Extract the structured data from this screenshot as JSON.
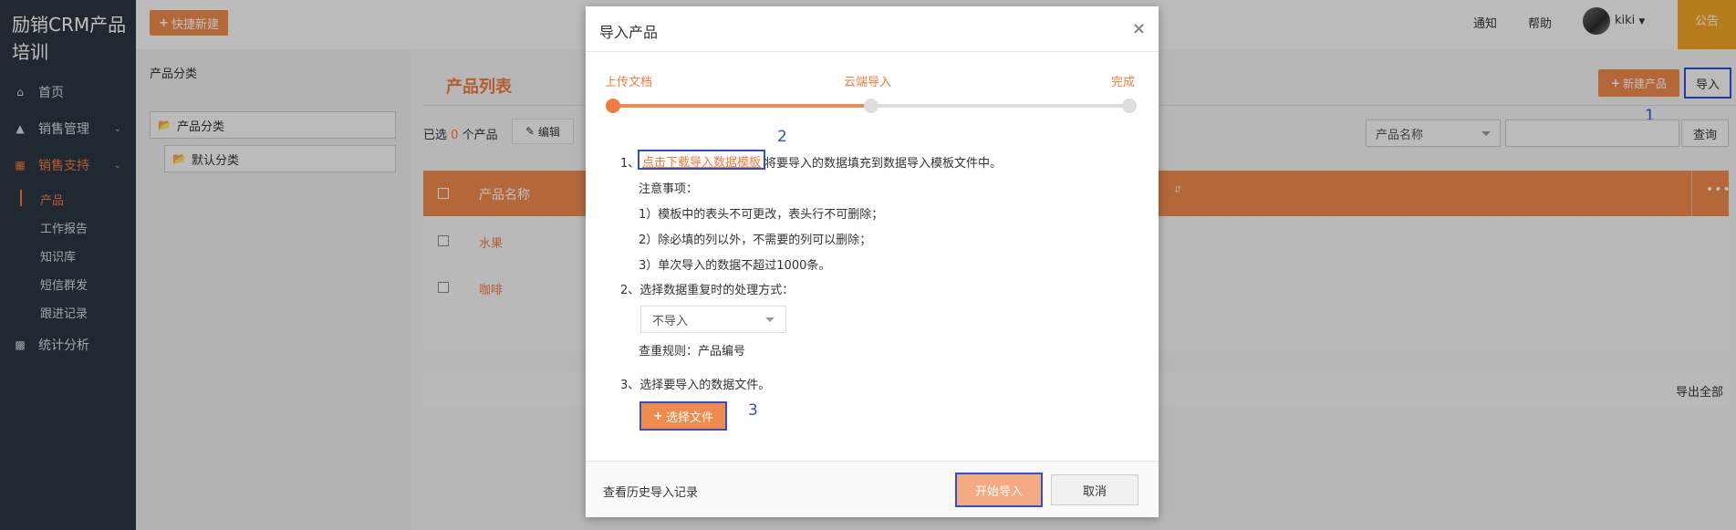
{
  "brand": "励销CRM产品培训",
  "sidebar": {
    "items": [
      {
        "label": "首页",
        "icon": "home-icon"
      },
      {
        "label": "销售管理",
        "icon": "area-chart-icon"
      },
      {
        "label": "销售支持",
        "icon": "file-icon"
      },
      {
        "label": "统计分析",
        "icon": "bar-chart-icon"
      }
    ],
    "sub_items": [
      "产品",
      "工作报告",
      "知识库",
      "短信群发",
      "跟进记录"
    ]
  },
  "header": {
    "quick_new": "快捷新建",
    "notify": "通知",
    "help": "帮助",
    "user": "kiki",
    "notice_tab": "公告"
  },
  "category": {
    "title": "产品分类",
    "root": "产品分类",
    "child": "默认分类"
  },
  "main": {
    "title": "产品列表",
    "new_product": "新建产品",
    "import": "导入",
    "selected_prefix": "已选",
    "selected_count": "0",
    "selected_suffix": "个产品",
    "edit": "编辑",
    "search_field": "产品名称",
    "query": "查询",
    "column_name": "产品名称",
    "rows": [
      "水果",
      "咖啡"
    ],
    "export_all": "导出全部"
  },
  "annotations": [
    "1",
    "2",
    "3"
  ],
  "modal": {
    "title": "导入产品",
    "steps": [
      "上传文档",
      "云端导入",
      "完成"
    ],
    "progress": 0.5,
    "step1_prefix": "1、",
    "download_link": "点击下载导入数据模板",
    "step1_suffix": "将要导入的数据填充到数据导入模板文件中。",
    "notes_title": "注意事项：",
    "notes": [
      "1）模板中的表头不可更改，表头行不可删除；",
      "2）除必填的列以外，不需要的列可以删除；",
      "3）单次导入的数据不超过1000条。"
    ],
    "step2": "2、选择数据重复时的处理方式：",
    "dup_option": "不导入",
    "dup_rule": "查重规则：产品编号",
    "step3": "3、选择要导入的数据文件。",
    "choose_file": "选择文件",
    "history": "查看历史导入记录",
    "start": "开始导入",
    "cancel": "取消"
  }
}
